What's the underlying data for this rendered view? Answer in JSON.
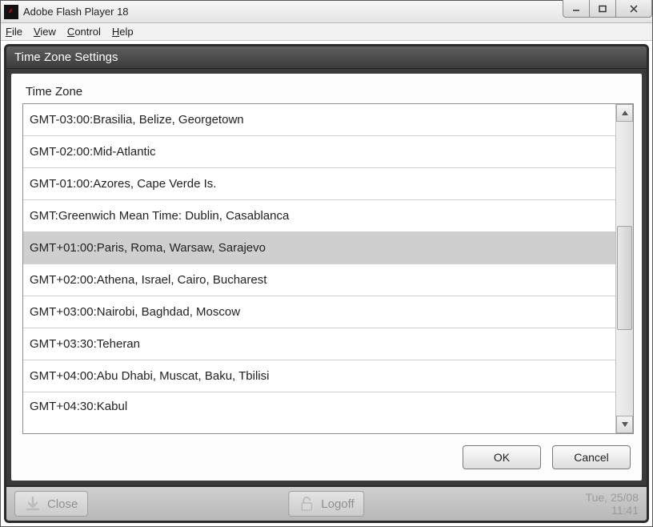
{
  "window": {
    "title": "Adobe Flash Player 18"
  },
  "menubar": {
    "file": "File",
    "view": "View",
    "control": "Control",
    "help": "Help"
  },
  "modal": {
    "title": "Time Zone Settings",
    "section_label": "Time Zone",
    "items": [
      {
        "label": "GMT-03:00:Brasilia, Belize, Georgetown",
        "selected": false
      },
      {
        "label": "GMT-02:00:Mid-Atlantic",
        "selected": false
      },
      {
        "label": "GMT-01:00:Azores, Cape Verde Is.",
        "selected": false
      },
      {
        "label": "GMT:Greenwich Mean Time: Dublin, Casablanca",
        "selected": false
      },
      {
        "label": "GMT+01:00:Paris, Roma, Warsaw, Sarajevo",
        "selected": true
      },
      {
        "label": "GMT+02:00:Athena, Israel, Cairo, Bucharest",
        "selected": false
      },
      {
        "label": "GMT+03:00:Nairobi, Baghdad, Moscow",
        "selected": false
      },
      {
        "label": "GMT+03:30:Teheran",
        "selected": false
      },
      {
        "label": "GMT+04:00:Abu Dhabi, Muscat, Baku, Tbilisi",
        "selected": false
      },
      {
        "label": "GMT+04:30:Kabul",
        "selected": false
      }
    ],
    "ok_label": "OK",
    "cancel_label": "Cancel"
  },
  "footer": {
    "close_label": "Close",
    "logoff_label": "Logoff",
    "date": "Tue, 25/08",
    "time": "11:41"
  }
}
